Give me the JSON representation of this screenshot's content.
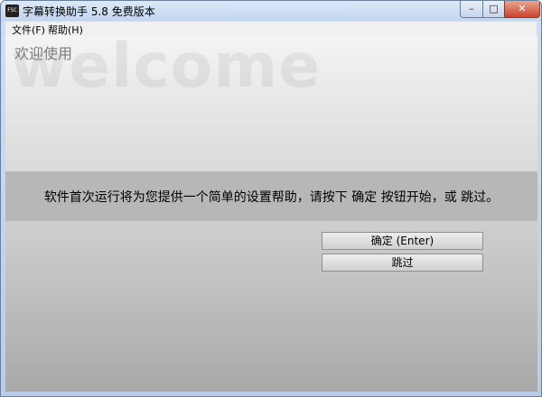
{
  "window": {
    "app_icon_text": "FSC",
    "title": "字幕转换助手 5.8 免费版本",
    "minimize_glyph": "–",
    "maximize_glyph": "□",
    "close_glyph": "✕"
  },
  "menu": [
    {
      "label": "文件(F)"
    },
    {
      "label": "帮助(H)"
    }
  ],
  "content": {
    "background_word": "welcome",
    "heading": "欢迎使用",
    "message": "软件首次运行将为您提供一个简单的设置帮助，请按下 确定 按钮开始，或 跳过。",
    "confirm_label": "确定 (Enter)",
    "skip_label": "跳过"
  },
  "colors": {
    "titlebar": "#c3d6ef",
    "close_button": "#c9452c",
    "band": "#b7b7b7"
  }
}
